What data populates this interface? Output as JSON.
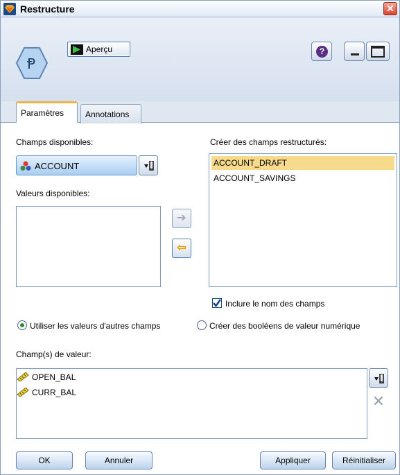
{
  "window": {
    "title": "Restructure"
  },
  "toolbar": {
    "preview_label": "Aperçu",
    "help_icon": "help-icon",
    "minimize_icon": "minimize-icon",
    "maximize_icon": "maximize-icon"
  },
  "tabs": [
    {
      "label": "Paramètres",
      "active": true
    },
    {
      "label": "Annotations",
      "active": false
    }
  ],
  "available_fields": {
    "label": "Champs disponibles:",
    "selected": "ACCOUNT"
  },
  "available_values": {
    "label": "Valeurs disponibles:",
    "items": []
  },
  "restructured_fields": {
    "label": "Créer des champs restructurés:",
    "items": [
      {
        "label": "ACCOUNT_DRAFT",
        "selected": true
      },
      {
        "label": "ACCOUNT_SAVINGS",
        "selected": false
      }
    ]
  },
  "include_field_name": {
    "label": "Inclure le nom des champs",
    "checked": true
  },
  "mode": {
    "option1": "Utiliser les valeurs d'autres champs",
    "option2": "Créer des booléens de valeur numérique",
    "selected": "option1"
  },
  "value_fields": {
    "label": "Champ(s) de valeur:",
    "items": [
      "OPEN_BAL",
      "CURR_BAL"
    ]
  },
  "buttons": {
    "ok": "OK",
    "cancel": "Annuler",
    "apply": "Appliquer",
    "reset": "Réinitialiser"
  },
  "colors": {
    "accent_tab": "#f0b44d",
    "selection": "#f8da8c",
    "radio_dot": "#2a8c2a"
  }
}
